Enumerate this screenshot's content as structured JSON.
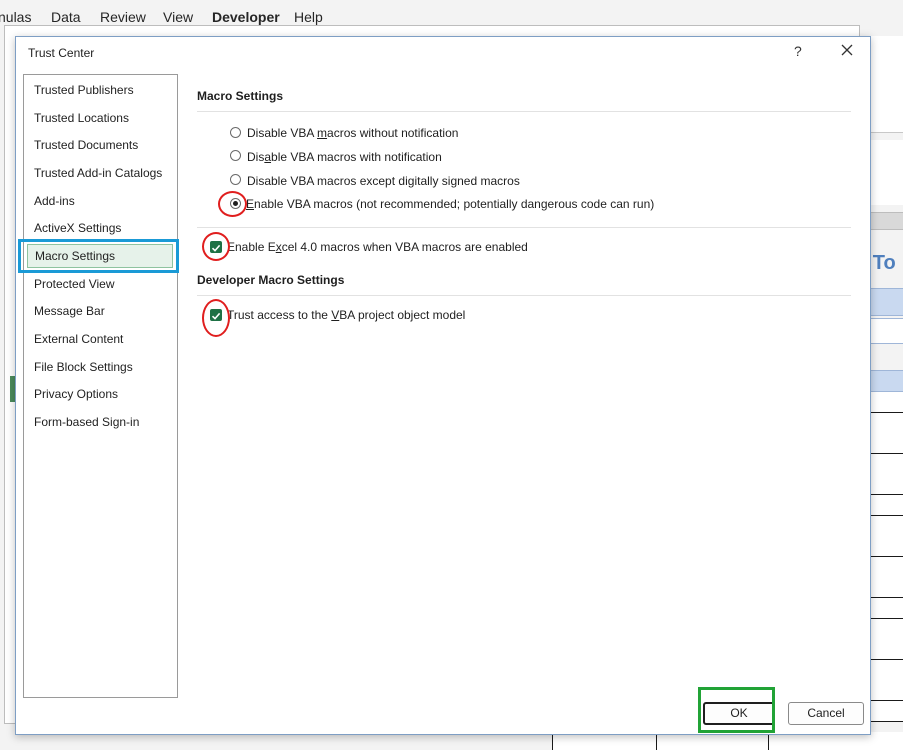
{
  "ribbon": {
    "tabs": [
      "nulas",
      "Data",
      "Review",
      "View",
      "Developer",
      "Help"
    ]
  },
  "sheet": {
    "title_fragment": "o To"
  },
  "dialog": {
    "title": "Trust Center",
    "help_glyph": "?",
    "close_glyph": "✕",
    "nav_items": [
      "Trusted Publishers",
      "Trusted Locations",
      "Trusted Documents",
      "Trusted Add-in Catalogs",
      "Add-ins",
      "ActiveX Settings",
      "Macro Settings",
      "Protected View",
      "Message Bar",
      "External Content",
      "File Block Settings",
      "Privacy Options",
      "Form-based Sign-in"
    ],
    "selected_nav": "Macro Settings",
    "macro_settings": {
      "title": "Macro Settings",
      "options": [
        {
          "pre": "Disable VBA ",
          "acc": "m",
          "post": "acros without notification",
          "selected": false
        },
        {
          "pre": "Dis",
          "acc": "a",
          "post": "ble VBA macros with notification",
          "selected": false
        },
        {
          "pre": "Disable VBA macros except di",
          "acc": "g",
          "post": "itally signed macros",
          "selected": false
        },
        {
          "pre": "",
          "acc": "E",
          "post": "nable VBA macros (not recommended; potentially dangerous code can run)",
          "selected": true
        }
      ],
      "excel4": {
        "pre": "Enable E",
        "acc": "x",
        "post": "cel 4.0 macros when VBA macros are enabled",
        "checked": true
      }
    },
    "developer_settings": {
      "title": "Developer Macro Settings",
      "trust_vba": {
        "pre": "Trust access to the ",
        "acc": "V",
        "post": "BA project object model",
        "checked": true
      }
    },
    "buttons": {
      "ok": "OK",
      "cancel": "Cancel"
    }
  },
  "colors": {
    "checkbox_fill": "#1e7145",
    "annotation_red": "#e01e1e",
    "annotation_blue": "#1a9ad6",
    "annotation_green": "#21a336"
  }
}
